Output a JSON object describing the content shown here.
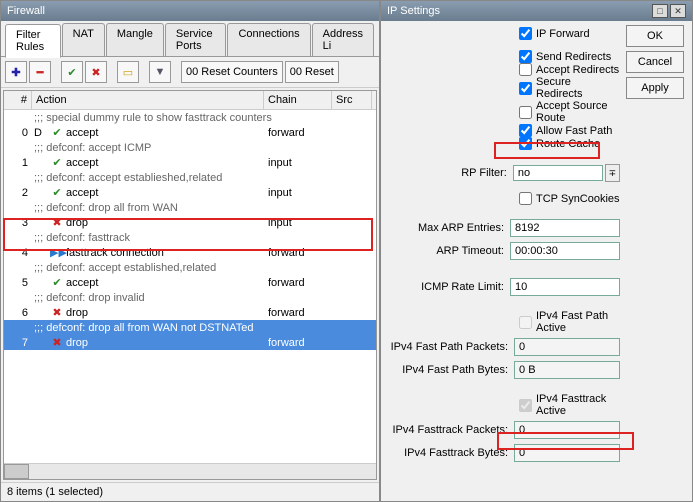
{
  "firewall": {
    "title": "Firewall",
    "tabs": [
      "Filter Rules",
      "NAT",
      "Mangle",
      "Service Ports",
      "Connections",
      "Address Li"
    ],
    "activeTab": 0,
    "toolbar": {
      "add": "✚",
      "remove": "━",
      "enable": "✔",
      "disable": "✖",
      "comment": "▭",
      "filter": "▼",
      "resetCounters": "00 Reset Counters",
      "resetAll": "00 Reset"
    },
    "columns": [
      "#",
      "Action",
      "Chain",
      "Src"
    ],
    "rows": [
      {
        "type": "comment",
        "text": ";;; special dummy rule to show fasttrack counters"
      },
      {
        "num": "0",
        "flag": "D",
        "icon": "✔",
        "iconColor": "#2a8a2a",
        "action": "accept",
        "chain": "forward"
      },
      {
        "type": "comment",
        "text": ";;; defconf: accept ICMP"
      },
      {
        "num": "1",
        "flag": "",
        "icon": "✔",
        "iconColor": "#2a8a2a",
        "action": "accept",
        "chain": "input"
      },
      {
        "type": "comment",
        "text": ";;; defconf: accept establieshed,related"
      },
      {
        "num": "2",
        "flag": "",
        "icon": "✔",
        "iconColor": "#2a8a2a",
        "action": "accept",
        "chain": "input"
      },
      {
        "type": "comment",
        "text": ";;; defconf: drop all from WAN"
      },
      {
        "num": "3",
        "flag": "",
        "icon": "✖",
        "iconColor": "#c22",
        "action": "drop",
        "chain": "input"
      },
      {
        "type": "comment",
        "text": ";;; defconf: fasttrack"
      },
      {
        "num": "4",
        "flag": "",
        "icon": "▶▶",
        "iconColor": "#2a7acc",
        "action": "fasttrack connection",
        "chain": "forward"
      },
      {
        "type": "comment",
        "text": ";;; defconf: accept established,related"
      },
      {
        "num": "5",
        "flag": "",
        "icon": "✔",
        "iconColor": "#2a8a2a",
        "action": "accept",
        "chain": "forward"
      },
      {
        "type": "comment",
        "text": ";;; defconf: drop invalid"
      },
      {
        "num": "6",
        "flag": "",
        "icon": "✖",
        "iconColor": "#c22",
        "action": "drop",
        "chain": "forward"
      },
      {
        "type": "comment",
        "text": ";;; defconf: drop all from WAN not DSTNATed",
        "selected": true
      },
      {
        "num": "7",
        "flag": "",
        "icon": "✖",
        "iconColor": "#c22",
        "action": "drop",
        "chain": "forward",
        "selected": true
      }
    ],
    "status": "8 items (1 selected)"
  },
  "ip": {
    "title": "IP Settings",
    "buttons": {
      "ok": "OK",
      "cancel": "Cancel",
      "apply": "Apply"
    },
    "checks": {
      "ipForward": "IP Forward",
      "sendRedirects": "Send Redirects",
      "acceptRedirects": "Accept Redirects",
      "secureRedirects": "Secure Redirects",
      "acceptSourceRoute": "Accept Source Route",
      "allowFastPath": "Allow Fast Path",
      "routeCache": "Route Cache",
      "tcpSynCookies": "TCP SynCookies",
      "ipv4FastPathActive": "IPv4 Fast Path Active",
      "ipv4FasttrackActive": "IPv4 Fasttrack Active"
    },
    "checkValues": {
      "ipForward": true,
      "sendRedirects": true,
      "acceptRedirects": false,
      "secureRedirects": true,
      "acceptSourceRoute": false,
      "allowFastPath": true,
      "routeCache": true,
      "tcpSynCookies": false,
      "ipv4FastPathActive": false,
      "ipv4FasttrackActive": true
    },
    "labels": {
      "rpFilter": "RP Filter:",
      "maxArp": "Max ARP Entries:",
      "arpTimeout": "ARP Timeout:",
      "icmpRate": "ICMP Rate Limit:",
      "fpPackets": "IPv4 Fast Path Packets:",
      "fpBytes": "IPv4 Fast Path Bytes:",
      "ftPackets": "IPv4 Fasttrack Packets:",
      "ftBytes": "IPv4 Fasttrack Bytes:"
    },
    "values": {
      "rpFilter": "no",
      "maxArp": "8192",
      "arpTimeout": "00:00:30",
      "icmpRate": "10",
      "fpPackets": "0",
      "fpBytes": "0 B",
      "ftPackets": "0",
      "ftBytes": "0"
    }
  }
}
